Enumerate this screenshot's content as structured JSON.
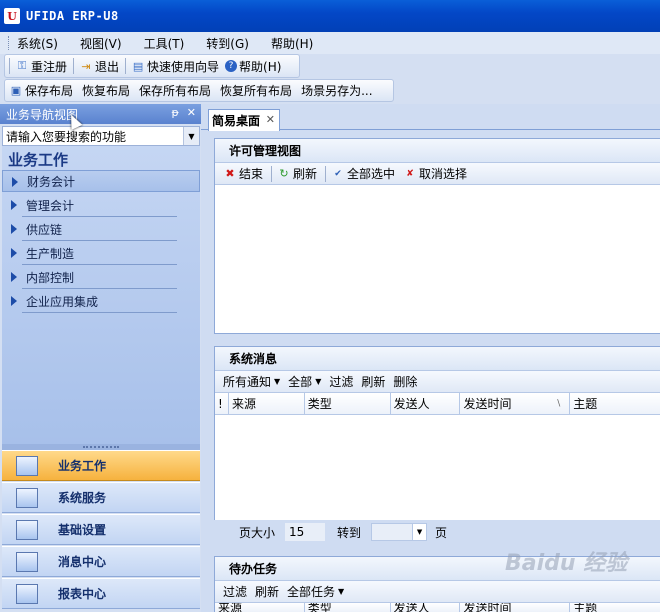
{
  "window": {
    "title": "UFIDA ERP-U8",
    "logo": "U"
  },
  "menu": [
    "系统(S)",
    "视图(V)",
    "工具(T)",
    "转到(G)",
    "帮助(H)"
  ],
  "toolbar1": {
    "reregister": "重注册",
    "exit": "退出",
    "quick_guide": "快速使用向导",
    "help": "帮助(H)"
  },
  "toolbar2": [
    "保存布局",
    "恢复布局",
    "保存所有布局",
    "恢复所有布局",
    "场景另存为..."
  ],
  "nav": {
    "header": "业务导航视图",
    "pin": "ᵽ",
    "close": "✕",
    "search_placeholder": "请输入您要搜索的功能",
    "section_title": "业务工作",
    "items": [
      "财务会计",
      "管理会计",
      "供应链",
      "生产制造",
      "内部控制",
      "企业应用集成"
    ],
    "bottom_buttons": [
      "业务工作",
      "系统服务",
      "基础设置",
      "消息中心",
      "报表中心"
    ]
  },
  "tab": {
    "label": "简易桌面",
    "close": "✕"
  },
  "license_panel": {
    "title": "许可管理视图",
    "tools": [
      "结束",
      "刷新",
      "全部选中",
      "取消选择"
    ]
  },
  "message_panel": {
    "title": "系统消息",
    "tools": [
      "所有通知",
      "全部",
      "过滤",
      "刷新",
      "删除"
    ],
    "columns": [
      "!",
      "来源",
      "类型",
      "发送人",
      "发送时间",
      "主题"
    ],
    "footer": {
      "page_size_label": "页大小",
      "page_size": "15",
      "goto_label": "转到",
      "page_label": "页"
    }
  },
  "todo_panel": {
    "title": "待办任务",
    "tools": [
      "过滤",
      "刷新",
      "全部任务"
    ],
    "columns": [
      "来源",
      "类型",
      "发送人",
      "发送时间",
      "主题"
    ]
  },
  "watermark": "Baidu 经验"
}
